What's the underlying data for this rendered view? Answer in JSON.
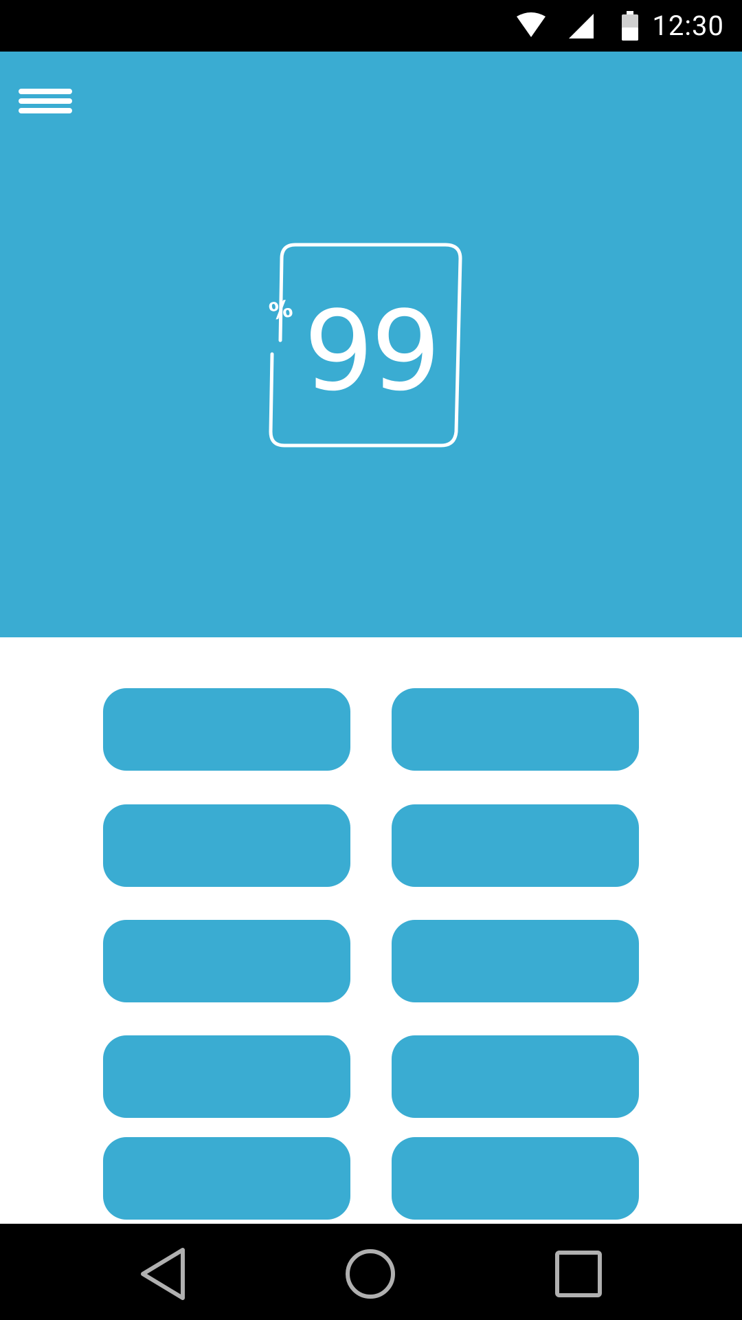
{
  "status_bar": {
    "time": "12:30",
    "icons": [
      "wifi-icon",
      "signal-icon",
      "battery-icon"
    ]
  },
  "header": {
    "menu_icon": "hamburger-menu-icon",
    "logo_text": "99",
    "logo_symbol": "%",
    "background_color": "#3AACD2"
  },
  "buttons": [
    {
      "label": ""
    },
    {
      "label": ""
    },
    {
      "label": ""
    },
    {
      "label": ""
    },
    {
      "label": ""
    },
    {
      "label": ""
    },
    {
      "label": ""
    },
    {
      "label": ""
    },
    {
      "label": ""
    },
    {
      "label": ""
    }
  ],
  "nav_bar": {
    "items": [
      "back-icon",
      "home-icon",
      "recents-icon"
    ]
  }
}
